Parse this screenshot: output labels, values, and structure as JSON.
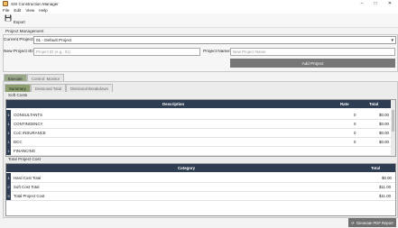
{
  "window": {
    "title": "SSI Construction Manager",
    "controls": [
      "–",
      "□",
      "✕"
    ]
  },
  "menu": [
    "File",
    "Edit",
    "View",
    "Help"
  ],
  "toolbar": {
    "export_label": "Export"
  },
  "project_management": {
    "section_title": "Project Management",
    "current_project_label": "Current Project:",
    "current_project_value": "01 - Default Project",
    "new_id_label": "New Project ID:",
    "new_id_placeholder": "Project ID (e.g., 01)",
    "new_name_label": "Project Name:",
    "new_name_placeholder": "New Project Name",
    "add_button": "Add Project"
  },
  "main_tabs": [
    "Execute",
    "Control: Monitor"
  ],
  "sub_tabs": [
    "Summary",
    "Divisional Total",
    "Divisional Breakdown"
  ],
  "soft_costs": {
    "title": "Soft Costs",
    "headers": [
      "Description",
      "Rate",
      "Total"
    ],
    "rows": [
      {
        "num": "1",
        "description": "CONSULTANTS",
        "rate": "0",
        "total": "$0.00"
      },
      {
        "num": "1",
        "description": "CONTINGENCY",
        "rate": "0",
        "total": "$0.00"
      },
      {
        "num": "1",
        "description": "CoC INSURANCE",
        "rate": "0",
        "total": "$0.00"
      },
      {
        "num": "1",
        "description": "DCC",
        "rate": "0",
        "total": "$0.00"
      },
      {
        "num": "1",
        "description": "FINANCING",
        "rate": "",
        "total": ""
      }
    ]
  },
  "total_cost": {
    "title": "Total Project Cost",
    "headers": [
      "Category",
      "Total"
    ],
    "rows": [
      {
        "num": "1",
        "category": "Hard Cost Total",
        "total": "$0.00"
      },
      {
        "num": "2",
        "category": "Soft Cost Total",
        "total": "$11.00"
      },
      {
        "num": "3",
        "category": "Total Project Cost",
        "total": "$11.00"
      }
    ]
  },
  "generate_button": "Generate PDF Report",
  "colors": {
    "header": "#2f3d52",
    "active_tab": "#8fa070",
    "button": "#777777"
  }
}
